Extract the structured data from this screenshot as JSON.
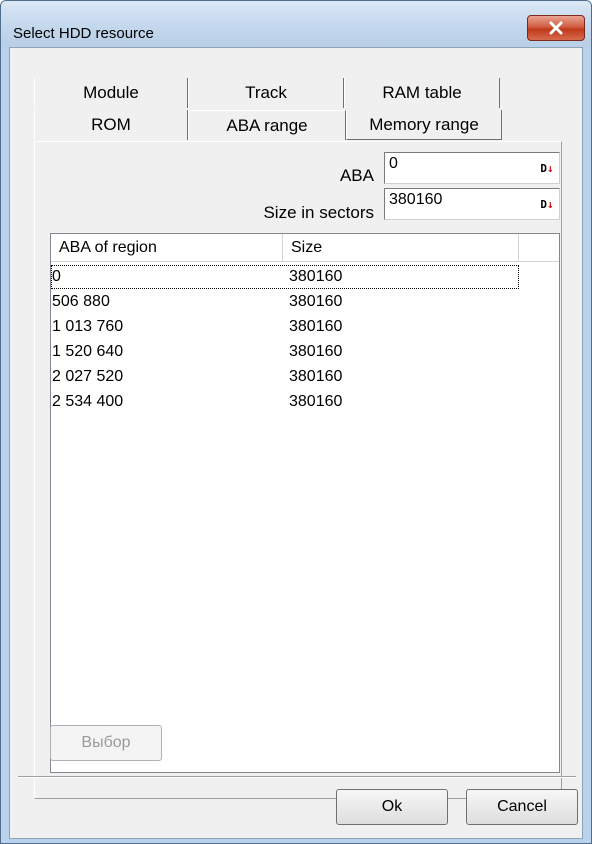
{
  "window": {
    "title": "Select HDD resource"
  },
  "tabs": {
    "row1": [
      "Module",
      "Track",
      "RAM table"
    ],
    "row2": [
      "ROM",
      "ABA range",
      "Memory range"
    ],
    "active": "ABA range"
  },
  "form": {
    "aba_label": "ABA",
    "aba_value": "0",
    "size_label": "Size in sectors",
    "size_value": "380160",
    "drop_glyph": "D↓"
  },
  "list": {
    "columns": [
      "ABA of region",
      "Size"
    ],
    "rows": [
      [
        "0",
        "380160"
      ],
      [
        "506 880",
        "380160"
      ],
      [
        "1 013 760",
        "380160"
      ],
      [
        "1 520 640",
        "380160"
      ],
      [
        "2 027 520",
        "380160"
      ],
      [
        "2 534 400",
        "380160"
      ]
    ]
  },
  "buttons": {
    "select": "Выбор",
    "ok": "Ok",
    "cancel": "Cancel"
  },
  "colors": {
    "close_button": "#c2391c",
    "drop_arrow": "#d01010"
  }
}
